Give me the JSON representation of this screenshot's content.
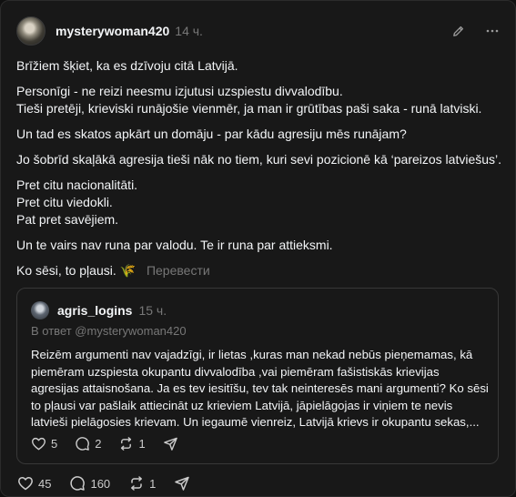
{
  "post": {
    "username": "mysterywoman420",
    "time": "14 ч.",
    "paragraphs": [
      [
        "Brīžiem šķiet, ka es dzīvoju citā Latvijā."
      ],
      [
        "Personīgi - ne reizi neesmu izjutusi uzspiestu divvalodību.",
        "Tieši pretēji, krieviski runājošie vienmēr, ja man ir grūtības paši saka - runā latviski."
      ],
      [
        "Un tad es skatos apkārt un domāju - par kādu agresiju mēs runājam?"
      ],
      [
        "Jo šobrīd skaļākā agresija tieši nāk no tiem, kuri sevi pozicionē kā ‘pareizos latviešus’."
      ],
      [
        "Pret citu nacionalitāti.",
        "Pret citu viedokli.",
        "Pat pret savējiem."
      ],
      [
        "Un te vairs nav runa par valodu. Te ir runa par attieksmi."
      ]
    ],
    "last_line": "Ko sēsi, to pļausi.",
    "emoji": "🌾",
    "translate_label": "Перевести",
    "likes": "45",
    "comments": "160",
    "reposts": "1"
  },
  "quoted": {
    "username": "agris_logins",
    "time": "15 ч.",
    "reply_to": "В ответ @mysterywoman420",
    "lines": [
      "Reizēm argumenti nav vajadzīgi, ir lietas ,kuras man nekad nebūs pieņemamas, kā",
      "piemēram uzspiesta okupantu divvalodība ,vai piemēram fašistiskās krievijas",
      "agresijas attaisnošana. Ja es tev iesitīšu, tev tak neinteresēs mani argumenti? Ko sēsi",
      "to pļausi var pašlaik attiecināt uz krieviem Latvijā, jāpielāgojas ir viņiem te nevis",
      "latvieši pielāgosies krievam. Un iegaumē vienreiz, Latvijā krievs ir okupantu sekas,..."
    ],
    "likes": "5",
    "comments": "2",
    "reposts": "1"
  },
  "colors": {
    "background": "#181818",
    "text": "#f3f5f7",
    "muted": "#777777",
    "border": "#383838"
  },
  "icons": [
    "pencil-icon",
    "more-icon",
    "heart-icon",
    "comment-icon",
    "repost-icon",
    "share-icon"
  ]
}
